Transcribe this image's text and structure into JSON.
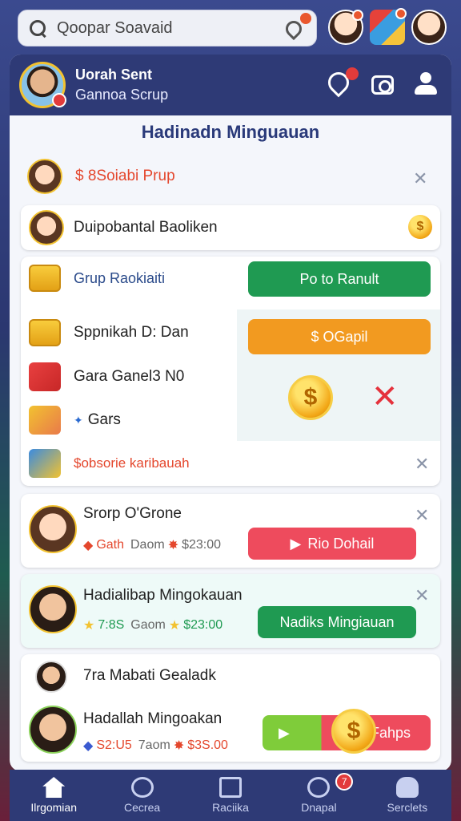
{
  "search": {
    "text": "Qoopar Soavaid"
  },
  "profile": {
    "name": "Uorah Sent",
    "subtitle": "Gannoa Scrup"
  },
  "section_title": "Hadinadn Minguauan",
  "rows": [
    {
      "label": "$ 8Soiabi Prup"
    },
    {
      "label": "Duipobantal Baoliken"
    },
    {
      "label": "Grup Raokiaiti",
      "button": "Po to Ranult"
    },
    {
      "label": "Sppnikah D: Dan",
      "button": "$ OGapil"
    },
    {
      "label": "Gara Ganel3 N0"
    },
    {
      "label": "Gars"
    },
    {
      "label": "$obsorie karibauah"
    }
  ],
  "cards": [
    {
      "title": "Srorp O'Grone",
      "stat1": "Gath",
      "stat2": "Daom",
      "amount": "$23:00",
      "button": "Rio Dohail"
    },
    {
      "title": "Hadialibap Mingokauan",
      "stat1": "7:8S",
      "stat2": "Gaom",
      "amount": "$23:00",
      "button": "Nadiks Mingiauan"
    },
    {
      "title": "7ra Mabati Gealadk"
    },
    {
      "title": "Hadallah Mingoakan",
      "stat1": "S2:U5",
      "stat2": "7aom",
      "amount": "$3S.00",
      "button": "Fahps"
    }
  ],
  "nav": [
    {
      "label": "Ilrgomian"
    },
    {
      "label": "Cecrea"
    },
    {
      "label": "Raciika"
    },
    {
      "label": "Dnapal",
      "badge": "7"
    },
    {
      "label": "Serclets"
    }
  ],
  "icons": {
    "coin": "$",
    "close": "✕",
    "play": "▶"
  }
}
